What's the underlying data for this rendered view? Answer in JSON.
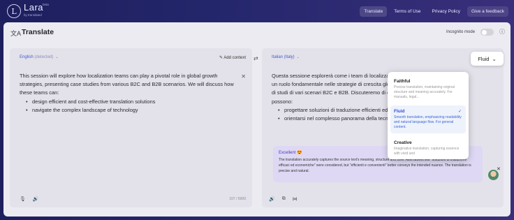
{
  "brand": {
    "logo": "L",
    "name": "Lara",
    "beta": "beta",
    "byline": "by translated"
  },
  "nav": [
    "Translate",
    "Terms of Use",
    "Privacy Policy",
    "Give a feedback"
  ],
  "header": {
    "title": "Translate",
    "incognito": "Incognito mode"
  },
  "source": {
    "lang": "English",
    "detected": "(detected)",
    "add_context": "Add context",
    "text": "This session will explore how localization teams can play a pivotal role in global growth strategies, presenting case studies from various B2C and B2B scenarios. We will discuss how these teams can:",
    "bullets": [
      "design efficient and cost-effective translation solutions",
      "navigate the complex landscape of technology"
    ],
    "count": "107 / 5000"
  },
  "target": {
    "lang": "Italian (Italy)",
    "lines": [
      "Questa sessione esplorerà come i team di localizzazione possano svolgere",
      "un ruolo fondamentale nelle strategie di crescita globale, presentando casi",
      "di studi di vari scenari B2C e B2B. Discuteremo di come questi team",
      "possono:"
    ],
    "bullets": [
      "progettare soluzioni di traduzione efficienti ed economiche",
      "orientarsi nel complesso panorama della tecnologia"
    ]
  },
  "quality": {
    "title": "Excellent 😍",
    "body": "The translation accurately captures the source text's meaning, structure and tone. Alternatives like \"soluzioni di traduzione efficaci ed economiche\" were considered, but \"efficienti e convenienti\" better conveys the intended nuance. The translation is precise and natural."
  },
  "style_menu": {
    "current": "Fluid",
    "options": [
      {
        "name": "Faithful",
        "desc": "Precise translation, maintaining original structure and meaning accurately. For manuals, legal..."
      },
      {
        "name": "Fluid",
        "desc": "Smooth translation, emphasizing readability and natural language flow. For general content."
      },
      {
        "name": "Creative",
        "desc": "Imaginative translation, capturing essence with vivid and"
      }
    ]
  },
  "colors": {
    "accent": "#3150d4",
    "topbar": "#1d1f5e",
    "card": "#ecebf1"
  }
}
